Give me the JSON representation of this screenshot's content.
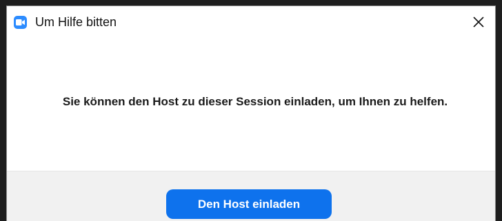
{
  "window": {
    "title": "Um Hilfe bitten",
    "app_icon": "zoom-video-camera-icon",
    "close_icon": "close-icon"
  },
  "main": {
    "message": "Sie können den Host zu dieser Session einladen, um Ihnen zu helfen."
  },
  "footer": {
    "primary_button_label": "Den Host einladen"
  },
  "colors": {
    "accent": "#0e72ed",
    "app_icon_bg": "#2d8cff",
    "footer_bg": "#f1f1f1"
  }
}
